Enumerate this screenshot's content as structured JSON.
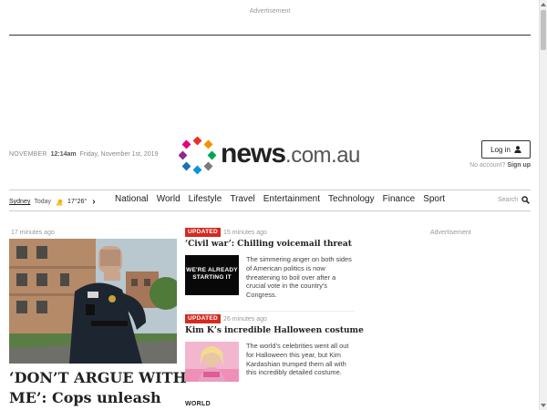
{
  "top_ad": {
    "label": "Advertisement"
  },
  "header": {
    "date_month": "NOVEMBER",
    "time": "12:14am",
    "date_full": "Friday, November 1st, 2019",
    "logo_text": "news",
    "logo_tld": ".com.au",
    "login_label": "Log in",
    "no_account_text": "No account?",
    "signup_label": "Sign up"
  },
  "weather": {
    "city": "Sydney",
    "day": "Today",
    "temps": "17°26°"
  },
  "nav": {
    "items": [
      "National",
      "World",
      "Lifestyle",
      "Travel",
      "Entertainment",
      "Technology",
      "Finance",
      "Sport"
    ]
  },
  "search": {
    "label": "Search"
  },
  "lead_story": {
    "timestamp": "17 minutes ago",
    "headline": "‘DON’T ARGUE WITH ME’: Cops unleash"
  },
  "stories": [
    {
      "badge": "UPDATED",
      "timestamp": "15 minutes ago",
      "headline": "‘Civil war’: Chilling voicemail threat",
      "thumb_caption": "WE'RE ALREADY STARTING IT",
      "summary": "The simmering anger on both sides of American politics is now threatening to boil over after a crucial vote in the country’s Congress."
    },
    {
      "badge": "UPDATED",
      "timestamp": "26 minutes ago",
      "headline": "Kim K’s incredible Halloween costume",
      "summary": "The world’s celebrities went all out for Halloween this year, but Kim Kardashian trumped them all with this incredibly detailed costume."
    }
  ],
  "section": {
    "label": "WORLD"
  },
  "right_ad": {
    "label": "Advertisement"
  },
  "colors": {
    "brand_red": "#d42a20",
    "text_dark": "#222222",
    "muted": "#999999"
  },
  "icons": {
    "logo_dots": "news-logo-dots-icon",
    "user": "user-icon",
    "weather": "partly-cloudy-icon",
    "chevron": "chevron-right-icon",
    "search": "search-icon"
  }
}
